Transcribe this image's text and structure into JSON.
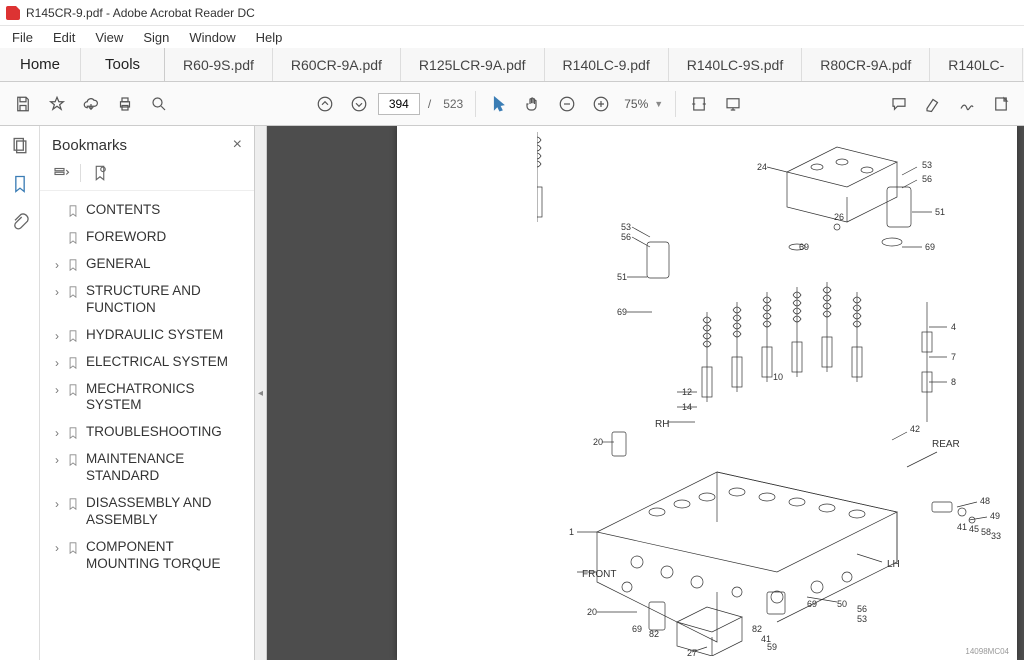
{
  "window_title": "R145CR-9.pdf - Adobe Acrobat Reader DC",
  "menu": {
    "file": "File",
    "edit": "Edit",
    "view": "View",
    "sign": "Sign",
    "window": "Window",
    "help": "Help"
  },
  "tabs": {
    "home": "Home",
    "tools": "Tools",
    "docs": [
      "R60-9S.pdf",
      "R60CR-9A.pdf",
      "R125LCR-9A.pdf",
      "R140LC-9.pdf",
      "R140LC-9S.pdf",
      "R80CR-9A.pdf",
      "R140LC-"
    ]
  },
  "page": {
    "current": "394",
    "sep": "/",
    "total": "523"
  },
  "zoom": {
    "level": "75%"
  },
  "bookmarks": {
    "title": "Bookmarks",
    "items": [
      {
        "label": "CONTENTS",
        "exp": false
      },
      {
        "label": "FOREWORD",
        "exp": false
      },
      {
        "label": "GENERAL",
        "exp": true
      },
      {
        "label": "STRUCTURE AND FUNCTION",
        "exp": true
      },
      {
        "label": "HYDRAULIC SYSTEM",
        "exp": true
      },
      {
        "label": "ELECTRICAL SYSTEM",
        "exp": true
      },
      {
        "label": "MECHATRONICS SYSTEM",
        "exp": true
      },
      {
        "label": "TROUBLESHOOTING",
        "exp": true
      },
      {
        "label": "MAINTENANCE STANDARD",
        "exp": true
      },
      {
        "label": "DISASSEMBLY AND ASSEMBLY",
        "exp": true
      },
      {
        "label": "COMPONENT MOUNTING TORQUE",
        "exp": true
      }
    ]
  },
  "diagram": {
    "labels": {
      "front": "FRONT",
      "rear": "REAR",
      "rh": "RH",
      "lh": "LH",
      "ref": "14098MC04"
    },
    "callouts": [
      "1",
      "4",
      "7",
      "8",
      "10",
      "12",
      "14",
      "20",
      "24",
      "26",
      "27",
      "33",
      "41",
      "42",
      "45",
      "48",
      "49",
      "50",
      "51",
      "53",
      "56",
      "58",
      "59",
      "69",
      "82"
    ]
  }
}
